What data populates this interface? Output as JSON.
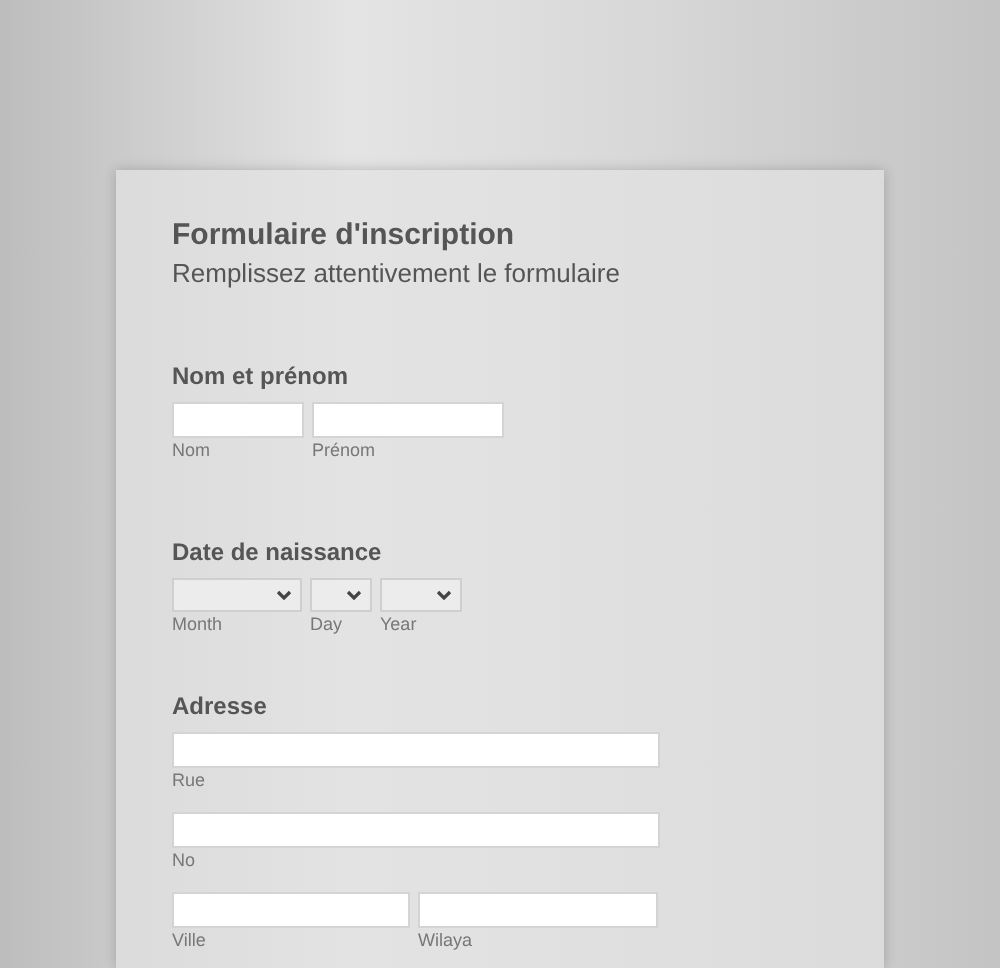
{
  "form": {
    "title": "Formulaire d'inscription",
    "subtitle": "Remplissez attentivement le formulaire",
    "sections": [
      {
        "heading": "Nom et prénom",
        "rows": [
          [
            {
              "kind": "text",
              "label": "Nom"
            },
            {
              "kind": "text",
              "label": "Prénom"
            }
          ]
        ]
      },
      {
        "heading": "Date de naissance",
        "rows": [
          [
            {
              "kind": "select",
              "label": "Month"
            },
            {
              "kind": "select",
              "label": "Day"
            },
            {
              "kind": "select",
              "label": "Year"
            }
          ]
        ]
      },
      {
        "heading": "Adresse",
        "rows": [
          [
            {
              "kind": "text",
              "label": "Rue"
            }
          ],
          [
            {
              "kind": "text",
              "label": "No"
            }
          ],
          [
            {
              "kind": "text",
              "label": "Ville"
            },
            {
              "kind": "text",
              "label": "Wilaya"
            }
          ]
        ]
      }
    ]
  }
}
